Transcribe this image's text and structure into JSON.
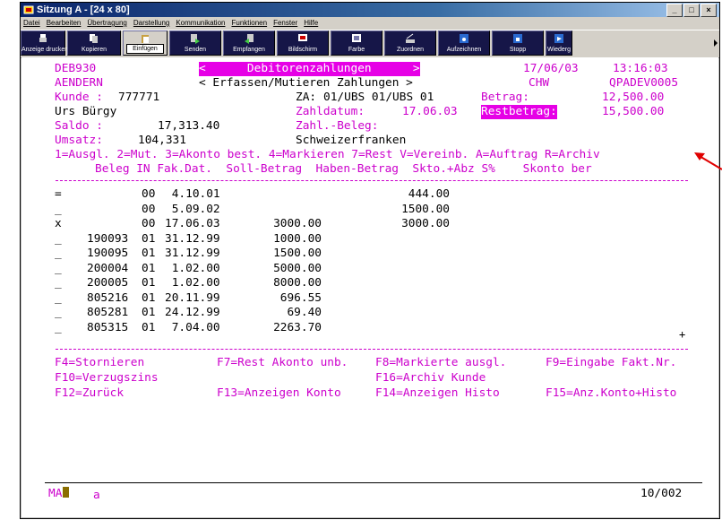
{
  "window": {
    "title": "Sitzung A - [24 x 80]"
  },
  "menu": [
    "Datei",
    "Bearbeiten",
    "Übertragung",
    "Darstellung",
    "Kommunikation",
    "Funktionen",
    "Fenster",
    "Hilfe"
  ],
  "toolbar": [
    {
      "label": "Anzeige drucken",
      "icon": "printer-icon"
    },
    {
      "label": "Kopieren",
      "icon": "copy-icon"
    },
    {
      "label": "Einfügen",
      "icon": "paste-icon",
      "active": true
    },
    {
      "label": "Senden",
      "icon": "send-icon"
    },
    {
      "label": "Empfangen",
      "icon": "receive-icon"
    },
    {
      "label": "Bildschirm",
      "icon": "screen-icon"
    },
    {
      "label": "Farbe",
      "icon": "color-icon"
    },
    {
      "label": "Zuordnen",
      "icon": "keyboard-map-icon"
    },
    {
      "label": "Aufzeichnen",
      "icon": "record-icon"
    },
    {
      "label": "Stopp",
      "icon": "stop-icon"
    },
    {
      "label": "Wiederg",
      "icon": "playback-icon"
    }
  ],
  "header": {
    "program": "DEB930",
    "title": "<      Debitorenzahlungen      >",
    "date": "17/06/03",
    "time": "13:16:03",
    "mode": "AENDERN",
    "subtitle": "< Erfassen/Mutieren Zahlungen >",
    "user": "CHW",
    "device": "QPADEV0005"
  },
  "customer": {
    "kunde_label": "Kunde :",
    "kunde": "777771",
    "za_label": "ZA:",
    "za": "01/UBS 01/UBS 01",
    "betrag_label": "Betrag:",
    "betrag": "12,500.00",
    "name": "Urs Bürgy",
    "zahldatum_label": "Zahldatum:",
    "zahldatum": "17.06.03",
    "restbetrag_label": "Restbetrag:",
    "restbetrag": "15,500.00",
    "saldo_label": "Saldo :",
    "saldo": "17,313.40",
    "zahlbeleg_label": "Zahl.-Beleg:",
    "umsatz_label": "Umsatz:",
    "umsatz": "104,331",
    "currency": "Schweizerfranken"
  },
  "options": "1=Ausgl. 2=Mut. 3=Akonto best. 4=Markieren 7=Rest V=Vereinb. A=Auftrag R=Archiv",
  "columns": "Beleg IN Fak.Dat.  Soll-Betrag  Haben-Betrag  Skto.+Abz S%    Skonto ber",
  "rows": [
    {
      "sel": "=",
      "beleg": "",
      "in": "00",
      "date": " 4.10.01",
      "soll": "",
      "haben": "444.00"
    },
    {
      "sel": "_",
      "beleg": "",
      "in": "00",
      "date": " 5.09.02",
      "soll": "",
      "haben": "1500.00"
    },
    {
      "sel": "x",
      "beleg": "",
      "in": "00",
      "date": "17.06.03",
      "soll": "3000.00",
      "haben": "3000.00"
    },
    {
      "sel": "_",
      "beleg": "190093",
      "in": "01",
      "date": "31.12.99",
      "soll": "1000.00",
      "haben": ""
    },
    {
      "sel": "_",
      "beleg": "190095",
      "in": "01",
      "date": "31.12.99",
      "soll": "1500.00",
      "haben": ""
    },
    {
      "sel": "_",
      "beleg": "200004",
      "in": "01",
      "date": " 1.02.00",
      "soll": "5000.00",
      "haben": ""
    },
    {
      "sel": "_",
      "beleg": "200005",
      "in": "01",
      "date": " 1.02.00",
      "soll": "8000.00",
      "haben": ""
    },
    {
      "sel": "_",
      "beleg": "805216",
      "in": "01",
      "date": "20.11.99",
      "soll": "696.55",
      "haben": ""
    },
    {
      "sel": "_",
      "beleg": "805281",
      "in": "01",
      "date": "24.12.99",
      "soll": "69.40",
      "haben": ""
    },
    {
      "sel": "_",
      "beleg": "805315",
      "in": "01",
      "date": " 7.04.00",
      "soll": "2263.70",
      "haben": ""
    }
  ],
  "more_indicator": "+",
  "fkeys": [
    [
      "F4=Stornieren",
      "F7=Rest Akonto unb.",
      "F8=Markierte ausgl.",
      "F9=Eingabe Fakt.Nr."
    ],
    [
      "F10=Verzugszins",
      "",
      "F16=Archiv Kunde",
      ""
    ],
    [
      "F12=Zurück",
      "F13=Anzeigen Konto",
      "F14=Anzeigen Histo",
      "F15=Anz.Konto+Histo"
    ]
  ],
  "status": {
    "mode": "MA",
    "input": "a",
    "position": "10/002"
  },
  "colors": {
    "accent": "#cc00cc",
    "highlight": "#e600e6",
    "toolbar_bg": "#161648",
    "arrow": "#e00000"
  }
}
